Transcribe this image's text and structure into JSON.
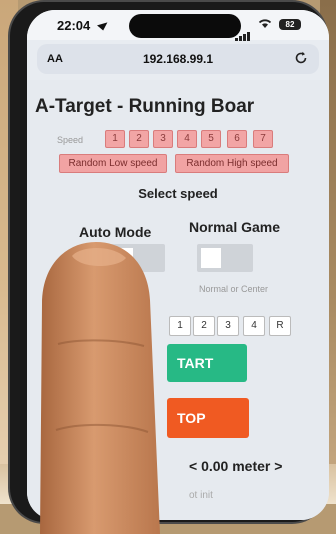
{
  "status_bar": {
    "time": "22:04",
    "battery": "82"
  },
  "browser": {
    "text_size_label": "AA",
    "url": "192.168.99.1"
  },
  "page": {
    "title": "A-Target - Running Boar",
    "speed_label": "Speed",
    "speed_buttons": [
      "1",
      "2",
      "3",
      "4",
      "5",
      "6",
      "7"
    ],
    "random_low_label": "Random Low speed",
    "random_high_label": "Random High speed",
    "select_speed": "Select speed",
    "auto_mode_label": "Auto Mode",
    "normal_game_label": "Normal Game",
    "mode_hint": "Normal or Center",
    "position_buttons": [
      "1",
      "2",
      "3",
      "4",
      "R"
    ],
    "start_label": "TART",
    "stop_label": "TOP",
    "distance": "< 0.00 meter >",
    "status": "ot init"
  },
  "colors": {
    "speed_button_bg": "#f2a5a5",
    "start_green": "#27b985",
    "stop_orange": "#f05a22"
  }
}
